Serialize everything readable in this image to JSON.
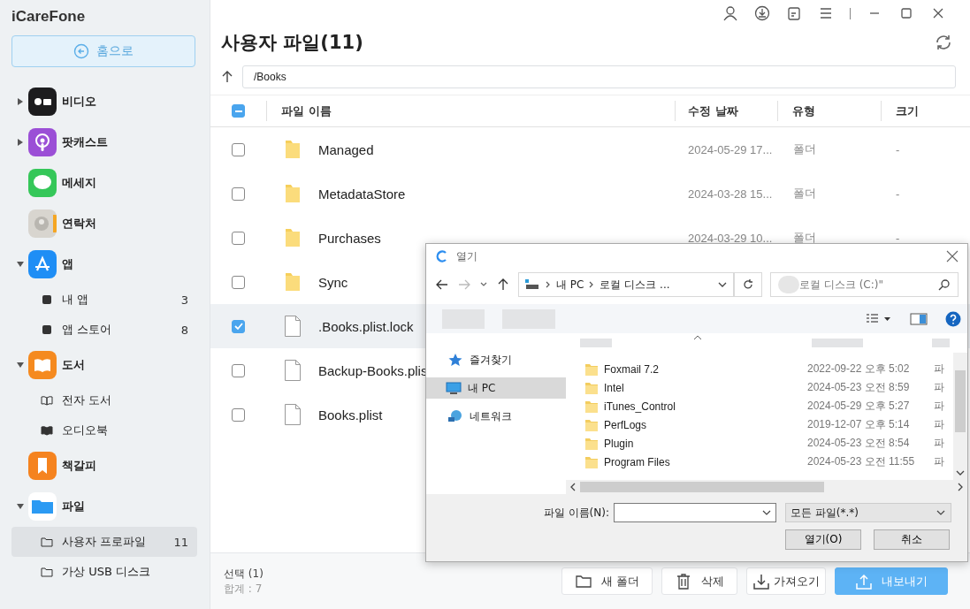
{
  "app": {
    "title": "iCareFone",
    "home_button": "홈으로"
  },
  "sidebar": {
    "items": [
      {
        "label": "비디오",
        "expanded": false,
        "selected": false
      },
      {
        "label": "팟캐스트",
        "expanded": false,
        "selected": false
      },
      {
        "label": "메세지",
        "selected": false
      },
      {
        "label": "연락처",
        "selected": false
      },
      {
        "label": "앱",
        "expanded": true,
        "selected": false,
        "children": [
          {
            "label": "내 앱",
            "count": "3",
            "selected": false
          },
          {
            "label": "앱 스토어",
            "count": "8",
            "selected": false
          }
        ]
      },
      {
        "label": "도서",
        "expanded": true,
        "selected": false,
        "children": [
          {
            "label": "전자 도서",
            "selected": false
          },
          {
            "label": "오디오북",
            "selected": false
          }
        ]
      },
      {
        "label": "책갈피",
        "selected": false
      },
      {
        "label": "파일",
        "expanded": true,
        "selected": false,
        "children": [
          {
            "label": "사용자 프로파일",
            "count": "11",
            "selected": true
          },
          {
            "label": "가상 USB 디스크",
            "selected": false
          }
        ]
      }
    ]
  },
  "main": {
    "title": "사용자 파일(11)",
    "path": "/Books",
    "table": {
      "select_all_partial": true,
      "columns": [
        "파일 이름",
        "수정 날짜",
        "유형",
        "크기"
      ],
      "rows": [
        {
          "kind": "folder",
          "name": "Managed",
          "date": "2024-05-29 17...",
          "type": "폴더",
          "size": "-",
          "checked": false
        },
        {
          "kind": "folder",
          "name": "MetadataStore",
          "date": "2024-03-28 15...",
          "type": "폴더",
          "size": "-",
          "checked": false
        },
        {
          "kind": "folder",
          "name": "Purchases",
          "date": "2024-03-29 10...",
          "type": "폴더",
          "size": "-",
          "checked": false
        },
        {
          "kind": "folder",
          "name": "Sync",
          "checked": false
        },
        {
          "kind": "file",
          "name": ".Books.plist.lock",
          "checked": true
        },
        {
          "kind": "file",
          "name": "Backup-Books.plis",
          "checked": false
        },
        {
          "kind": "file",
          "name": "Books.plist",
          "checked": false
        }
      ]
    },
    "footer": {
      "selection": "선택 (1)",
      "total": "합계 : 7",
      "buttons": [
        {
          "kind": "new-folder",
          "label": "새 폴더"
        },
        {
          "kind": "delete",
          "label": "삭제"
        },
        {
          "kind": "import",
          "label": "가져오기"
        },
        {
          "kind": "export",
          "label": "내보내기"
        }
      ]
    }
  },
  "dialog": {
    "title": "열기",
    "breadcrumb": [
      "내 PC",
      "로컬 디스크 ..."
    ],
    "search_placeholder": "로컬 디스크 (C:)\"",
    "nav": [
      {
        "label": "즐겨찾기",
        "selected": false
      },
      {
        "label": "내 PC",
        "selected": true
      },
      {
        "label": "네트워크",
        "selected": false
      }
    ],
    "files": [
      {
        "name": "Foxmail 7.2",
        "date": "2022-09-22 오후 5:02",
        "type": "파"
      },
      {
        "name": "Intel",
        "date": "2024-05-23 오전 8:59",
        "type": "파"
      },
      {
        "name": "iTunes_Control",
        "date": "2024-05-29 오후 5:27",
        "type": "파"
      },
      {
        "name": "PerfLogs",
        "date": "2019-12-07 오후 5:14",
        "type": "파"
      },
      {
        "name": "Plugin",
        "date": "2024-05-23 오전 8:54",
        "type": "파"
      },
      {
        "name": "Program Files",
        "date": "2024-05-23 오전 11:55",
        "type": "파"
      }
    ],
    "filename_label": "파일 이름(N):",
    "filter": "모든 파일(*.*)",
    "open_button": "열기(O)",
    "cancel_button": "취소"
  }
}
